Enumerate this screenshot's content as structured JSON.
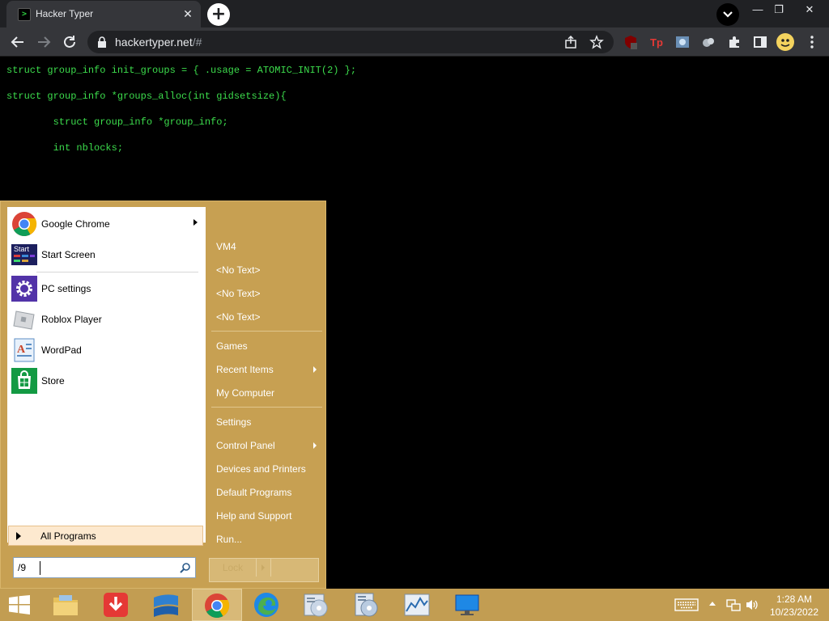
{
  "browser": {
    "tab_title": "Hacker Typer",
    "tab_favicon_text": ">",
    "new_tab": "+",
    "url_domain": "hackertyper.net",
    "url_path": "/#"
  },
  "code_lines": [
    "struct group_info init_groups = { .usage = ATOMIC_INIT(2) };",
    "struct group_info *groups_alloc(int gidsetsize){",
    "        struct group_info *group_info;",
    "        int nblocks;"
  ],
  "start_menu": {
    "pinned": [
      {
        "label": "Google Chrome",
        "icon": "chrome-icon",
        "submenu": true
      },
      {
        "label": "Start Screen",
        "icon": "start-screen-icon",
        "icon_text": "Start"
      },
      {
        "label": "PC settings",
        "icon": "gear-icon"
      },
      {
        "label": "Roblox Player",
        "icon": "roblox-icon"
      },
      {
        "label": "WordPad",
        "icon": "wordpad-icon"
      },
      {
        "label": "Store",
        "icon": "store-icon"
      }
    ],
    "all_programs": "All Programs",
    "search_value": "/9",
    "right_items": [
      {
        "label": "VM4"
      },
      {
        "label": "<No Text>"
      },
      {
        "label": "<No Text>"
      },
      {
        "label": "<No Text>"
      },
      {
        "label": "Games"
      },
      {
        "label": "Recent Items",
        "submenu": true
      },
      {
        "label": "My Computer"
      },
      {
        "label": "Settings"
      },
      {
        "label": "Control Panel",
        "submenu": true
      },
      {
        "label": "Devices and Printers"
      },
      {
        "label": "Default Programs"
      },
      {
        "label": "Help and Support"
      },
      {
        "label": "Run..."
      }
    ],
    "lock_label": "Lock"
  },
  "taskbar": {
    "time": "1:28 AM",
    "date": "10/23/2022"
  },
  "colors": {
    "code": "#3cdc4c",
    "start_menu": "#c7a052",
    "taskbar": "#c29d52"
  }
}
